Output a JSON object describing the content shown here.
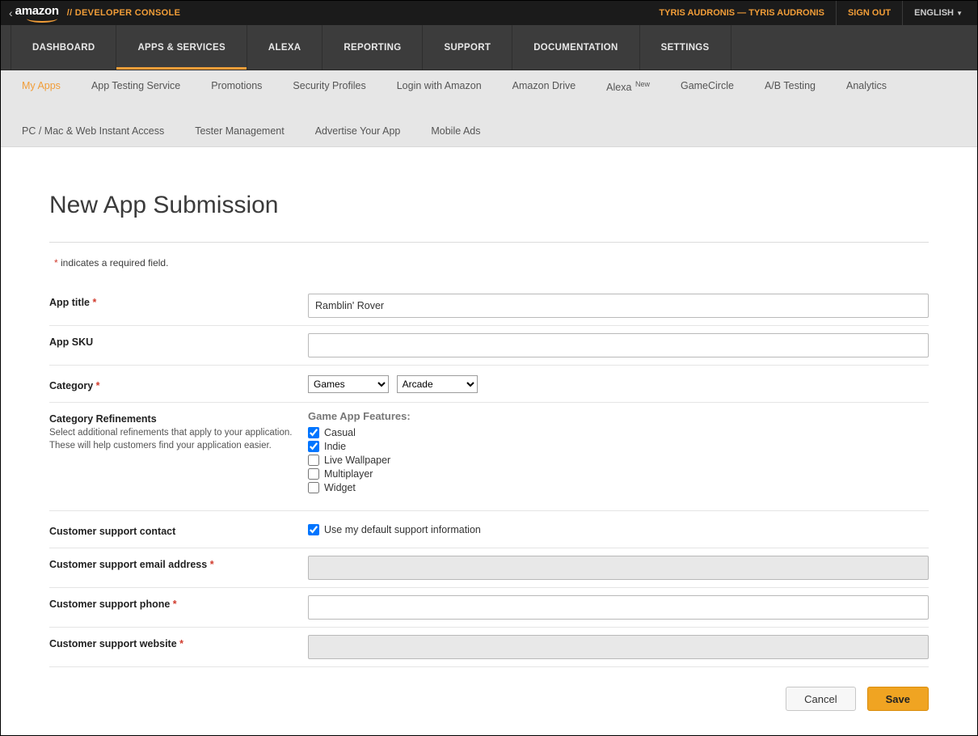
{
  "header": {
    "logo_text": "amazon",
    "console_label": "// DEVELOPER CONSOLE",
    "user_line": "TYRIS AUDRONIS — TYRIS AUDRONIS",
    "signout": "SIGN OUT",
    "language": "ENGLISH"
  },
  "main_nav": {
    "items": [
      "DASHBOARD",
      "APPS & SERVICES",
      "ALEXA",
      "REPORTING",
      "SUPPORT",
      "DOCUMENTATION",
      "SETTINGS"
    ],
    "active_index": 1
  },
  "sub_nav": {
    "row1": [
      {
        "label": "My Apps",
        "active": true
      },
      {
        "label": "App Testing Service"
      },
      {
        "label": "Promotions"
      },
      {
        "label": "Security Profiles"
      },
      {
        "label": "Login with Amazon"
      },
      {
        "label": "Amazon Drive"
      },
      {
        "label": "Alexa",
        "sup": "New"
      },
      {
        "label": "GameCircle"
      },
      {
        "label": "A/B Testing"
      },
      {
        "label": "Analytics"
      }
    ],
    "row2": [
      {
        "label": "PC / Mac & Web Instant Access"
      },
      {
        "label": "Tester Management"
      },
      {
        "label": "Advertise Your App"
      },
      {
        "label": "Mobile Ads"
      }
    ]
  },
  "page": {
    "title": "New App Submission",
    "required_note": "indicates a required field."
  },
  "form": {
    "app_title": {
      "label": "App title",
      "required": true,
      "value": "Ramblin' Rover"
    },
    "app_sku": {
      "label": "App SKU",
      "required": false,
      "value": ""
    },
    "category": {
      "label": "Category",
      "required": true,
      "select1": "Games",
      "select2": "Arcade"
    },
    "refinements": {
      "label": "Category Refinements",
      "sub": "Select additional refinements that apply to your application. These will help customers find your application easier.",
      "features_title": "Game App Features:",
      "features": [
        {
          "label": "Casual",
          "checked": true
        },
        {
          "label": "Indie",
          "checked": true
        },
        {
          "label": "Live Wallpaper",
          "checked": false
        },
        {
          "label": "Multiplayer",
          "checked": false
        },
        {
          "label": "Widget",
          "checked": false
        }
      ]
    },
    "support_contact": {
      "label": "Customer support contact",
      "checkbox_label": "Use my default support information",
      "checked": true
    },
    "support_email": {
      "label": "Customer support email address",
      "required": true,
      "value": ""
    },
    "support_phone": {
      "label": "Customer support phone",
      "required": true,
      "value": ""
    },
    "support_website": {
      "label": "Customer support website",
      "required": true,
      "value": ""
    }
  },
  "buttons": {
    "cancel": "Cancel",
    "save": "Save"
  }
}
